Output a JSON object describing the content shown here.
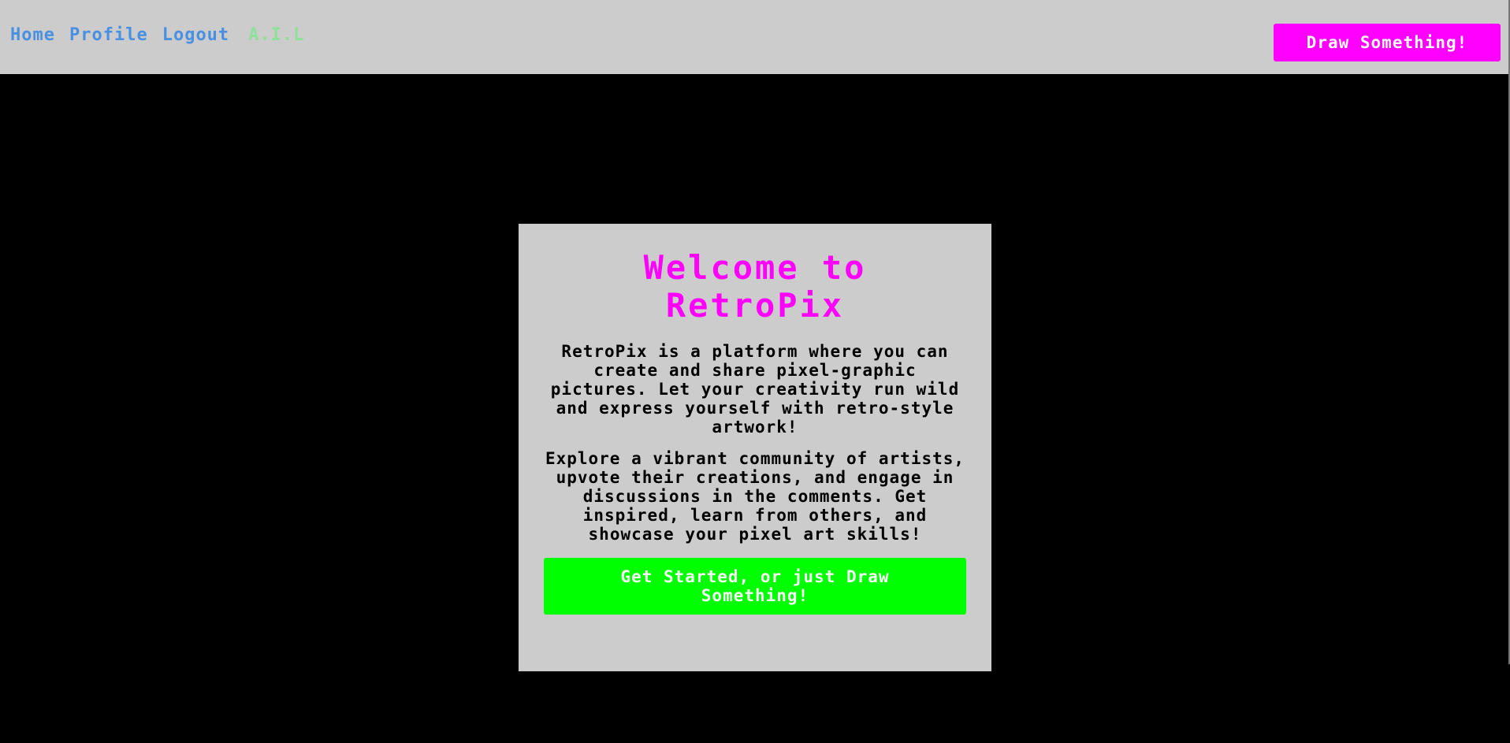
{
  "nav": {
    "links": [
      "Home",
      "Profile",
      "Logout"
    ],
    "brand": "A.I.L",
    "draw_button": "Draw Something!"
  },
  "card": {
    "title": "Welcome to RetroPix",
    "paragraph1": "RetroPix is a platform where you can create and share pixel-graphic pictures. Let your creativity run wild and express yourself with retro-style artwork!",
    "paragraph2": "Explore a vibrant community of artists, upvote their creations, and engage in discussions in the comments. Get inspired, learn from others, and showcase your pixel art skills!",
    "cta_button": "Get Started, or just Draw Something!"
  },
  "colors": {
    "background": "#000000",
    "navbar": "#cccccc",
    "link": "#4a90e2",
    "brand": "#8fe09a",
    "accent": "#ff00ff",
    "cta": "#00ff00"
  }
}
